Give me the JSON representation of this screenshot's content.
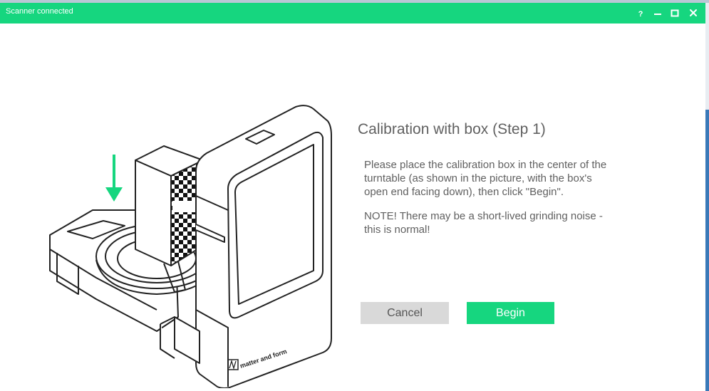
{
  "window": {
    "title": "Scanner connected",
    "controls": [
      "help-icon",
      "minimize-icon",
      "maximize-icon",
      "close-icon"
    ]
  },
  "illustration": {
    "brand": "matter and form",
    "icons": [
      "down-arrow-icon"
    ]
  },
  "dialog": {
    "heading": "Calibration with box (Step 1)",
    "instruction": "Please place the calibration box in the center of the turntable (as shown in the picture, with the box's open end facing down), then click \"Begin\".",
    "note": "NOTE! There may be a short-lived grinding noise - this is normal!"
  },
  "buttons": {
    "cancel": "Cancel",
    "begin": "Begin"
  },
  "colors": {
    "accent": "#16d67f",
    "cancel_bg": "#d9d9d9",
    "text": "#616161",
    "window_edge": "#3a79b8"
  }
}
